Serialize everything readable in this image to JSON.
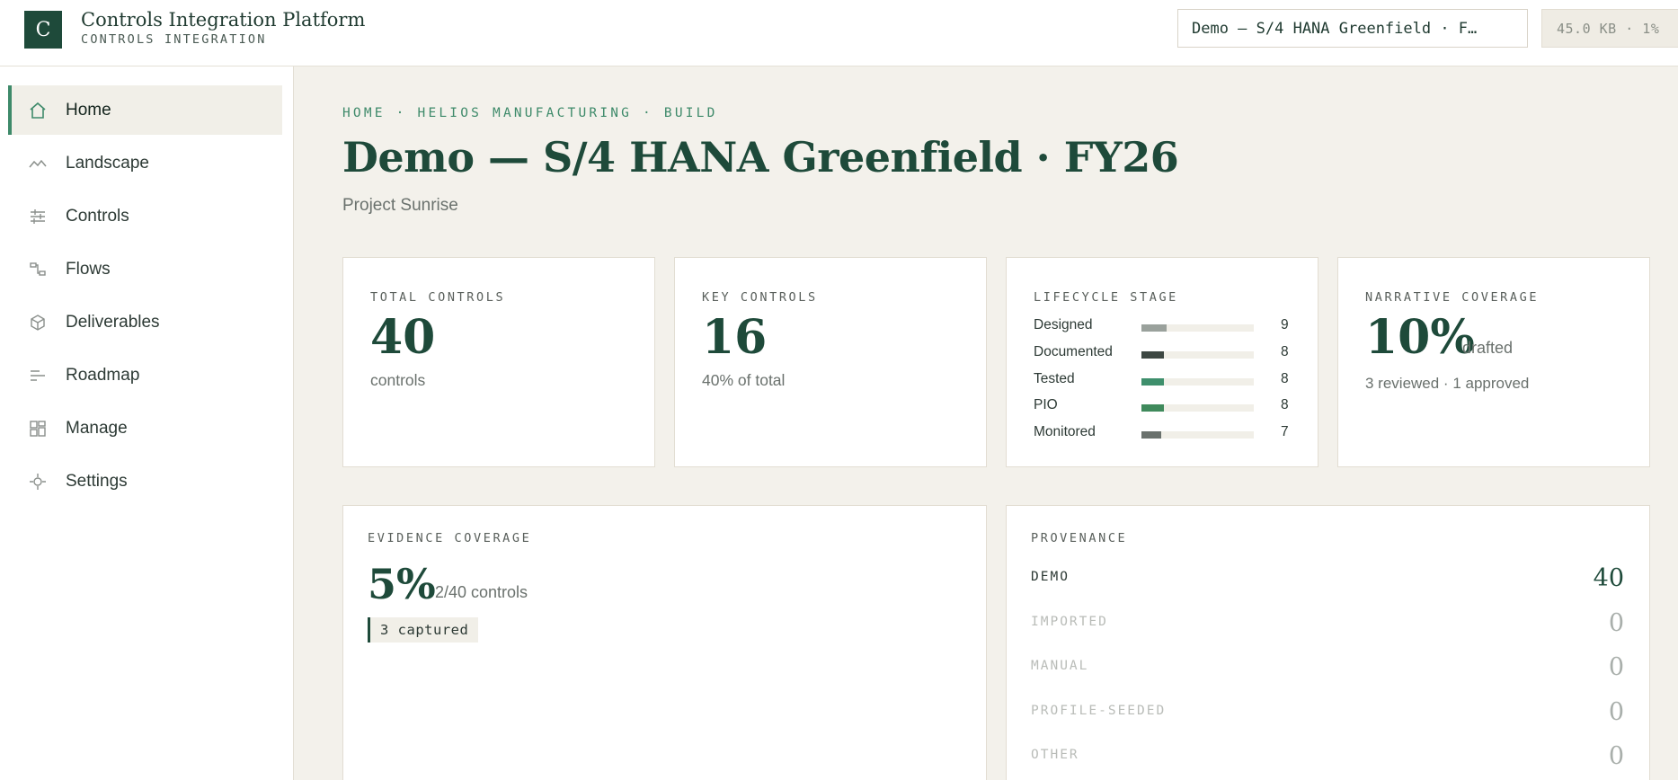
{
  "app": {
    "logo_letter": "C",
    "title": "Controls Integration Platform",
    "subtitle": "CONTROLS INTEGRATION",
    "project_selector": "Demo — S/4 HANA Greenfield · F…",
    "storage_badge": "45.0 KB · 1%"
  },
  "sidebar": {
    "items": [
      {
        "label": "Home",
        "icon": "home-icon",
        "active": true
      },
      {
        "label": "Landscape",
        "icon": "landscape-icon",
        "active": false
      },
      {
        "label": "Controls",
        "icon": "sliders-icon",
        "active": false
      },
      {
        "label": "Flows",
        "icon": "flow-icon",
        "active": false
      },
      {
        "label": "Deliverables",
        "icon": "cube-icon",
        "active": false
      },
      {
        "label": "Roadmap",
        "icon": "roadmap-icon",
        "active": false
      },
      {
        "label": "Manage",
        "icon": "grid-icon",
        "active": false
      },
      {
        "label": "Settings",
        "icon": "gear-icon",
        "active": false
      }
    ]
  },
  "page": {
    "breadcrumb": "HOME · HELIOS MANUFACTURING · BUILD",
    "title": "Demo — S/4 HANA Greenfield · FY26",
    "subtitle": "Project Sunrise"
  },
  "stats": {
    "total": {
      "label": "TOTAL CONTROLS",
      "value": "40",
      "note": "controls"
    },
    "key": {
      "label": "KEY CONTROLS",
      "value": "16",
      "note": "40% of total"
    },
    "lifecycle": {
      "label": "LIFECYCLE STAGE",
      "max": 40,
      "stages": [
        {
          "name": "Designed",
          "count": 9,
          "color": "#9aa19c"
        },
        {
          "name": "Documented",
          "count": 8,
          "color": "#3d4742"
        },
        {
          "name": "Tested",
          "count": 8,
          "color": "#3e8f6c"
        },
        {
          "name": "PIO",
          "count": 8,
          "color": "#3f8a5c"
        },
        {
          "name": "Monitored",
          "count": 7,
          "color": "#6a716d"
        }
      ]
    },
    "narrative": {
      "label": "NARRATIVE COVERAGE",
      "value": "10%",
      "unit": "drafted",
      "note": "3 reviewed · 1 approved"
    }
  },
  "evidence": {
    "label": "EVIDENCE COVERAGE",
    "value": "5%",
    "unit": "2/40 controls",
    "badge": "3 captured"
  },
  "provenance": {
    "label": "PROVENANCE",
    "rows": [
      {
        "name": "DEMO",
        "value": "40",
        "muted": false
      },
      {
        "name": "IMPORTED",
        "value": "0",
        "muted": true
      },
      {
        "name": "MANUAL",
        "value": "0",
        "muted": true
      },
      {
        "name": "PROFILE-SEEDED",
        "value": "0",
        "muted": true
      },
      {
        "name": "OTHER",
        "value": "0",
        "muted": true
      }
    ]
  },
  "colors": {
    "brand": "#1e4a3a",
    "accent": "#3e8a6a",
    "muted_text": "#b9bcb8"
  }
}
